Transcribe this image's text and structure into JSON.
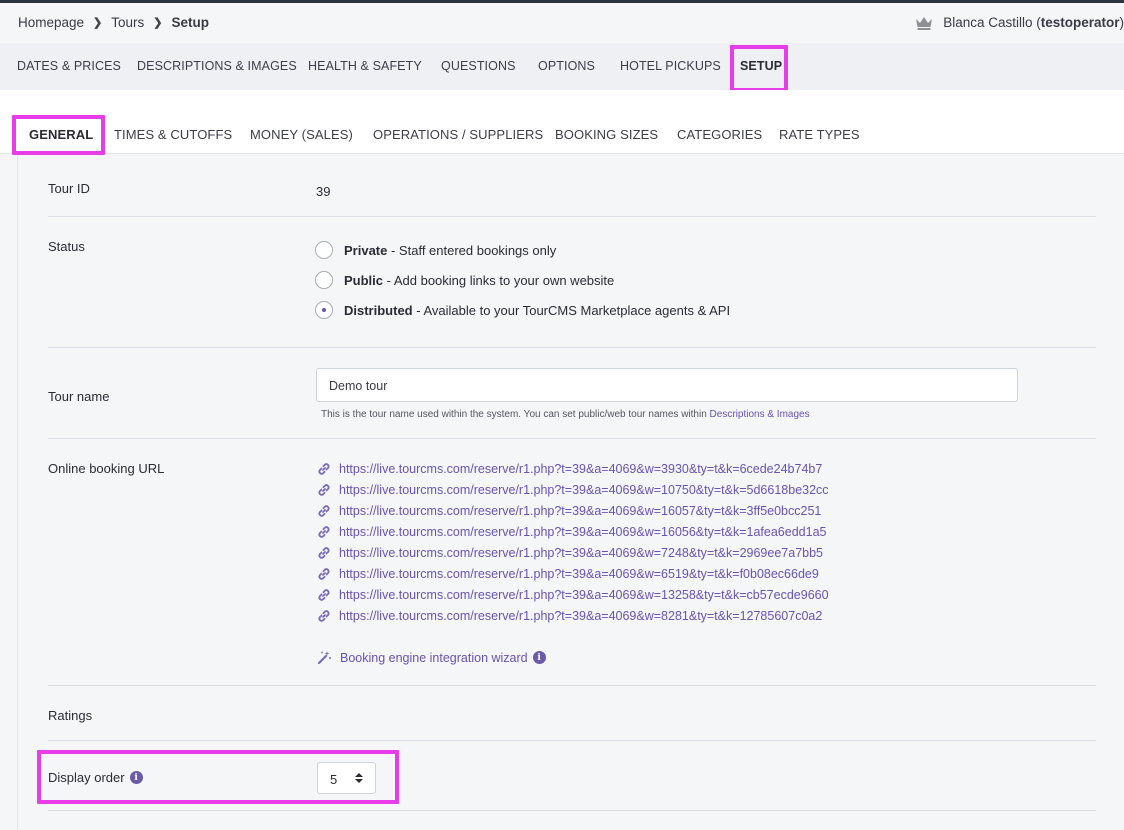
{
  "breadcrumb": {
    "items": [
      "Homepage",
      "Tours",
      "Setup"
    ]
  },
  "user": {
    "name": "Blanca Castillo",
    "account": "testoperator"
  },
  "main_tabs": [
    "DATES & PRICES",
    "DESCRIPTIONS & IMAGES",
    "HEALTH & SAFETY",
    "QUESTIONS",
    "OPTIONS",
    "HOTEL PICKUPS",
    "SETUP"
  ],
  "main_tabs_active": "SETUP",
  "sub_tabs": [
    "GENERAL",
    "TIMES & CUTOFFS",
    "MONEY (SALES)",
    "OPERATIONS / SUPPLIERS",
    "BOOKING SIZES",
    "CATEGORIES",
    "RATE TYPES"
  ],
  "sub_tabs_active": "GENERAL",
  "form": {
    "tour_id": {
      "label": "Tour ID",
      "value": "39"
    },
    "status": {
      "label": "Status",
      "options": [
        {
          "title": "Private",
          "desc": " - Staff entered bookings only",
          "checked": false
        },
        {
          "title": "Public",
          "desc": " - Add booking links to your own website",
          "checked": false
        },
        {
          "title": "Distributed",
          "desc": " - Available to your TourCMS Marketplace agents & API",
          "checked": true
        }
      ]
    },
    "tour_name": {
      "label": "Tour name",
      "value": "Demo tour",
      "help": "This is the tour name used within the system. You can set public/web tour names within ",
      "help_link": "Descriptions & Images"
    },
    "booking_url": {
      "label": "Online booking URL",
      "urls": [
        "https://live.tourcms.com/reserve/r1.php?t=39&a=4069&w=3930&ty=t&k=6cede24b74b7",
        "https://live.tourcms.com/reserve/r1.php?t=39&a=4069&w=10750&ty=t&k=5d6618be32cc",
        "https://live.tourcms.com/reserve/r1.php?t=39&a=4069&w=16057&ty=t&k=3ff5e0bcc251",
        "https://live.tourcms.com/reserve/r1.php?t=39&a=4069&w=16056&ty=t&k=1afea6edd1a5",
        "https://live.tourcms.com/reserve/r1.php?t=39&a=4069&w=7248&ty=t&k=2969ee7a7bb5",
        "https://live.tourcms.com/reserve/r1.php?t=39&a=4069&w=6519&ty=t&k=f0b08ec66de9",
        "https://live.tourcms.com/reserve/r1.php?t=39&a=4069&w=13258&ty=t&k=cb57ecde9660",
        "https://live.tourcms.com/reserve/r1.php?t=39&a=4069&w=8281&ty=t&k=12785607c0a2"
      ],
      "wizard": "Booking engine integration wizard"
    },
    "ratings": {
      "label": "Ratings"
    },
    "display_order": {
      "label": "Display order",
      "value": "5"
    }
  },
  "colors": {
    "highlight": "#e83ce8",
    "link": "#6753b3",
    "accent": "#6b5aa8"
  }
}
